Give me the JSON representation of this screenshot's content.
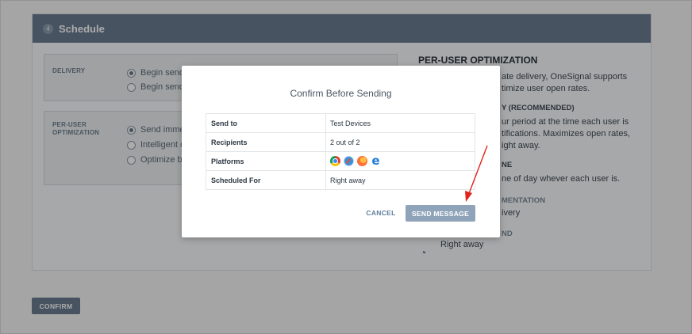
{
  "schedule": {
    "step_number": "4",
    "title": "Schedule",
    "delivery": {
      "label": "DELIVERY",
      "options": [
        "Begin sendi",
        "Begin sendi"
      ]
    },
    "per_user": {
      "label_line1": "PER-USER",
      "label_line2": "OPTIMIZATION",
      "options": [
        "Send immed",
        "Intelligent d",
        "Optimize by"
      ]
    }
  },
  "info": {
    "title": "PER-USER OPTIMIZATION",
    "line1": "ate delivery, OneSignal supports",
    "line2": "timize user open rates.",
    "heading_recommended": "Y (RECOMMENDED)",
    "line3": "ur period at the time each user is",
    "line4": "tifications. Maximizes open rates,",
    "line5": "ight away.",
    "heading_time": "NE",
    "line6": "ne of day whever each user is.",
    "heading_implementation": "MENTATION",
    "line7": "ivery",
    "heading_end": "ND",
    "line8": "Right away"
  },
  "footer": {
    "confirm_label": "CONFIRM"
  },
  "modal": {
    "title": "Confirm Before Sending",
    "rows": [
      {
        "key": "Send to",
        "value": "Test Devices"
      },
      {
        "key": "Recipients",
        "value": "2 out of 2"
      },
      {
        "key": "Platforms",
        "value": ""
      },
      {
        "key": "Scheduled For",
        "value": "Right away"
      }
    ],
    "platform_icons": [
      "chrome-icon",
      "safari-icon",
      "firefox-icon",
      "edge-icon"
    ],
    "cancel_label": "CANCEL",
    "send_label": "SEND MESSAGE"
  },
  "colors": {
    "header": "#6a7d90",
    "send_button": "#90a4b9",
    "cancel_text": "#5d7e9a",
    "arrow": "#e0241b"
  }
}
